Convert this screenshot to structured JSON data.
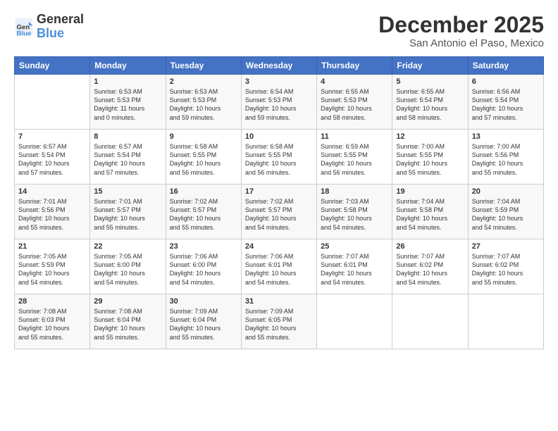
{
  "header": {
    "logo_general": "General",
    "logo_blue": "Blue",
    "month": "December 2025",
    "location": "San Antonio el Paso, Mexico"
  },
  "days_of_week": [
    "Sunday",
    "Monday",
    "Tuesday",
    "Wednesday",
    "Thursday",
    "Friday",
    "Saturday"
  ],
  "weeks": [
    [
      {
        "num": "",
        "info": ""
      },
      {
        "num": "1",
        "info": "Sunrise: 6:53 AM\nSunset: 5:53 PM\nDaylight: 11 hours\nand 0 minutes."
      },
      {
        "num": "2",
        "info": "Sunrise: 6:53 AM\nSunset: 5:53 PM\nDaylight: 10 hours\nand 59 minutes."
      },
      {
        "num": "3",
        "info": "Sunrise: 6:54 AM\nSunset: 5:53 PM\nDaylight: 10 hours\nand 59 minutes."
      },
      {
        "num": "4",
        "info": "Sunrise: 6:55 AM\nSunset: 5:53 PM\nDaylight: 10 hours\nand 58 minutes."
      },
      {
        "num": "5",
        "info": "Sunrise: 6:55 AM\nSunset: 5:54 PM\nDaylight: 10 hours\nand 58 minutes."
      },
      {
        "num": "6",
        "info": "Sunrise: 6:56 AM\nSunset: 5:54 PM\nDaylight: 10 hours\nand 57 minutes."
      }
    ],
    [
      {
        "num": "7",
        "info": "Sunrise: 6:57 AM\nSunset: 5:54 PM\nDaylight: 10 hours\nand 57 minutes."
      },
      {
        "num": "8",
        "info": "Sunrise: 6:57 AM\nSunset: 5:54 PM\nDaylight: 10 hours\nand 57 minutes."
      },
      {
        "num": "9",
        "info": "Sunrise: 6:58 AM\nSunset: 5:55 PM\nDaylight: 10 hours\nand 56 minutes."
      },
      {
        "num": "10",
        "info": "Sunrise: 6:58 AM\nSunset: 5:55 PM\nDaylight: 10 hours\nand 56 minutes."
      },
      {
        "num": "11",
        "info": "Sunrise: 6:59 AM\nSunset: 5:55 PM\nDaylight: 10 hours\nand 56 minutes."
      },
      {
        "num": "12",
        "info": "Sunrise: 7:00 AM\nSunset: 5:55 PM\nDaylight: 10 hours\nand 55 minutes."
      },
      {
        "num": "13",
        "info": "Sunrise: 7:00 AM\nSunset: 5:56 PM\nDaylight: 10 hours\nand 55 minutes."
      }
    ],
    [
      {
        "num": "14",
        "info": "Sunrise: 7:01 AM\nSunset: 5:56 PM\nDaylight: 10 hours\nand 55 minutes."
      },
      {
        "num": "15",
        "info": "Sunrise: 7:01 AM\nSunset: 5:57 PM\nDaylight: 10 hours\nand 55 minutes."
      },
      {
        "num": "16",
        "info": "Sunrise: 7:02 AM\nSunset: 5:57 PM\nDaylight: 10 hours\nand 55 minutes."
      },
      {
        "num": "17",
        "info": "Sunrise: 7:02 AM\nSunset: 5:57 PM\nDaylight: 10 hours\nand 54 minutes."
      },
      {
        "num": "18",
        "info": "Sunrise: 7:03 AM\nSunset: 5:58 PM\nDaylight: 10 hours\nand 54 minutes."
      },
      {
        "num": "19",
        "info": "Sunrise: 7:04 AM\nSunset: 5:58 PM\nDaylight: 10 hours\nand 54 minutes."
      },
      {
        "num": "20",
        "info": "Sunrise: 7:04 AM\nSunset: 5:59 PM\nDaylight: 10 hours\nand 54 minutes."
      }
    ],
    [
      {
        "num": "21",
        "info": "Sunrise: 7:05 AM\nSunset: 5:59 PM\nDaylight: 10 hours\nand 54 minutes."
      },
      {
        "num": "22",
        "info": "Sunrise: 7:05 AM\nSunset: 6:00 PM\nDaylight: 10 hours\nand 54 minutes."
      },
      {
        "num": "23",
        "info": "Sunrise: 7:06 AM\nSunset: 6:00 PM\nDaylight: 10 hours\nand 54 minutes."
      },
      {
        "num": "24",
        "info": "Sunrise: 7:06 AM\nSunset: 6:01 PM\nDaylight: 10 hours\nand 54 minutes."
      },
      {
        "num": "25",
        "info": "Sunrise: 7:07 AM\nSunset: 6:01 PM\nDaylight: 10 hours\nand 54 minutes."
      },
      {
        "num": "26",
        "info": "Sunrise: 7:07 AM\nSunset: 6:02 PM\nDaylight: 10 hours\nand 54 minutes."
      },
      {
        "num": "27",
        "info": "Sunrise: 7:07 AM\nSunset: 6:02 PM\nDaylight: 10 hours\nand 55 minutes."
      }
    ],
    [
      {
        "num": "28",
        "info": "Sunrise: 7:08 AM\nSunset: 6:03 PM\nDaylight: 10 hours\nand 55 minutes."
      },
      {
        "num": "29",
        "info": "Sunrise: 7:08 AM\nSunset: 6:04 PM\nDaylight: 10 hours\nand 55 minutes."
      },
      {
        "num": "30",
        "info": "Sunrise: 7:09 AM\nSunset: 6:04 PM\nDaylight: 10 hours\nand 55 minutes."
      },
      {
        "num": "31",
        "info": "Sunrise: 7:09 AM\nSunset: 6:05 PM\nDaylight: 10 hours\nand 55 minutes."
      },
      {
        "num": "",
        "info": ""
      },
      {
        "num": "",
        "info": ""
      },
      {
        "num": "",
        "info": ""
      }
    ]
  ]
}
